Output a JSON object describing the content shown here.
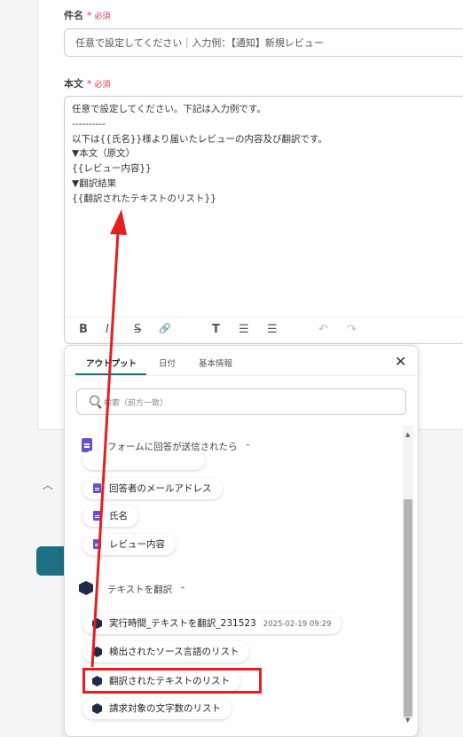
{
  "subject": {
    "label": "件名",
    "required": "必須",
    "placeholder": "任意で設定してください｜入力例：【通知】新規レビュー"
  },
  "body": {
    "label": "本文",
    "required": "必須",
    "text": "任意で設定してください。下記は入力例です。\n----------\n以下は{{氏名}}様より届いたレビューの内容及び翻訳です。\n▼本文（原文）\n{{レビュー内容}}\n▼翻訳結果\n{{翻訳されたテキストのリスト}}"
  },
  "toolbar": {
    "bold": "B",
    "italic": "I",
    "strike": "S",
    "link": "🔗",
    "text_size": "T",
    "ul": "☰",
    "ol": "☰",
    "undo": "↶",
    "redo": "↷"
  },
  "popup": {
    "tabs": [
      "アウトプット",
      "日付",
      "基本情報"
    ],
    "close": "✕",
    "search_placeholder": "検索（前方一致）",
    "section1": {
      "title": "フォームに回答が送信されたら",
      "chevron": "⌃",
      "items": [
        "回答者のメールアドレス",
        "氏名",
        "レビュー内容"
      ]
    },
    "section2": {
      "title": "テキストを翻訳",
      "chevron": "⌃",
      "items": [
        {
          "label": "実行時間_テキストを翻訳_231523",
          "timestamp": "2025-02-19 09:29"
        },
        {
          "label": "検出されたソース言語のリスト"
        },
        {
          "label": "翻訳されたテキストのリスト"
        },
        {
          "label": "請求対象の文字数のリスト"
        }
      ]
    }
  },
  "colors": {
    "accent": "#1d6f84",
    "required": "#e0344b",
    "annotation": "#e51e1e",
    "form_icon": "#6b4fc9",
    "translate_icon": "#1f2b48"
  }
}
